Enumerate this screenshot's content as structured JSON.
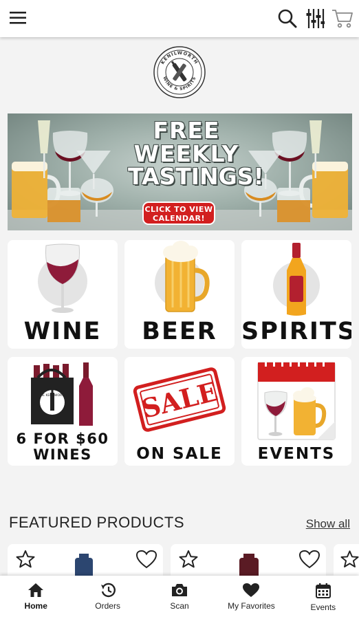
{
  "header": {
    "menu_icon": "hamburger-menu-icon",
    "search_icon": "search-icon",
    "filter_icon": "filter-sliders-icon",
    "cart_icon": "shopping-cart-icon"
  },
  "logo": {
    "top_text": "KENILWORTH",
    "bottom_text": "WINE & SPIRITS"
  },
  "banner": {
    "line1": "FREE",
    "line2": "WEEKLY",
    "line3": "TASTINGS!",
    "cta_line1": "CLICK TO VIEW",
    "cta_line2": "CALENDAR!"
  },
  "categories": [
    {
      "label": "WINE"
    },
    {
      "label": "BEER"
    },
    {
      "label": "SPIRITS"
    },
    {
      "label_line1": "6 FOR $60",
      "label_line2": "WINES",
      "bag_text": "THE KENILWORTH"
    },
    {
      "label": "ON SALE",
      "stamp": "SALE"
    },
    {
      "label": "EVENTS"
    }
  ],
  "featured": {
    "title": "FEATURED PRODUCTS",
    "show_all": "Show all"
  },
  "bottom_nav": [
    {
      "label": "Home",
      "icon": "home-icon",
      "active": true
    },
    {
      "label": "Orders",
      "icon": "history-icon"
    },
    {
      "label": "Scan",
      "icon": "camera-icon"
    },
    {
      "label": "My Favorites",
      "icon": "heart-icon"
    },
    {
      "label": "Events",
      "icon": "calendar-icon"
    }
  ],
  "colors": {
    "accent_red": "#d21f1f",
    "wine_red": "#8e1b3a",
    "beer_gold": "#f2b233"
  }
}
